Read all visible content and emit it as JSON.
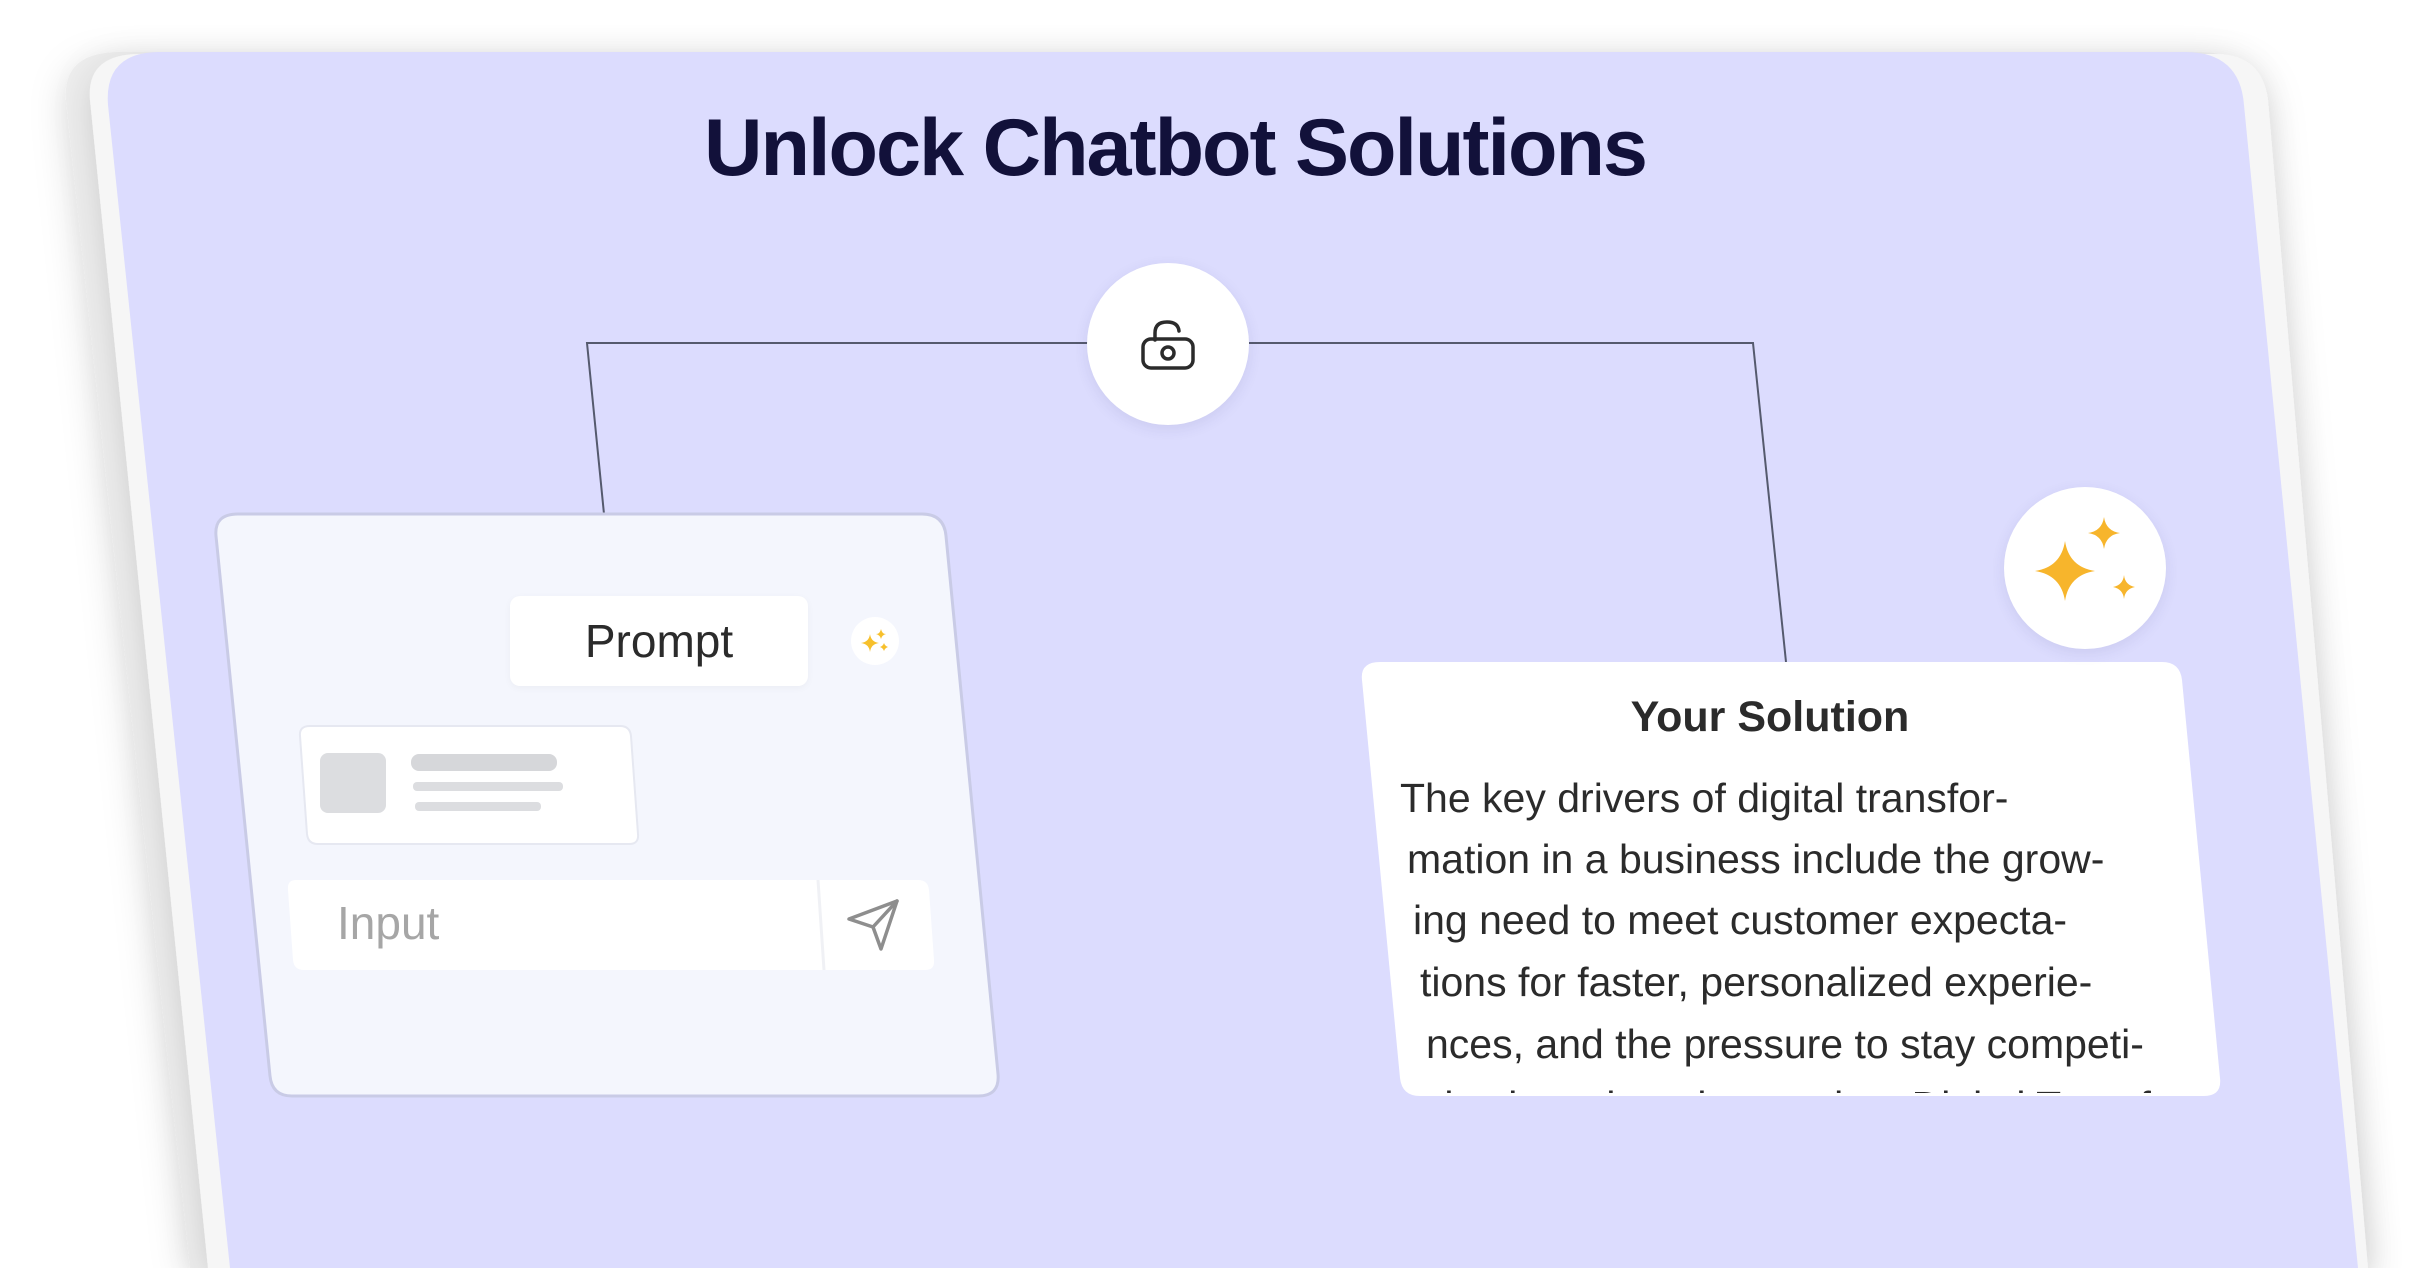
{
  "title": "Unlock Chatbot Solutions",
  "colors": {
    "card_background": "#dcdcfe",
    "title": "#12113a",
    "sparkle": "#f7b52c",
    "panel": "#f4f6fd",
    "line": "#555a6e"
  },
  "icons": {
    "lock": "unlocked-padlock-icon",
    "sparkle": "sparkles-icon",
    "send": "paper-plane-send-icon"
  },
  "chat_panel": {
    "prompt_label": "Prompt",
    "input_placeholder": "Input"
  },
  "solution_panel": {
    "title": "Your Solution",
    "lines": [
      "The key drivers of digital transfor-",
      "mation in a business include the grow-",
      "ing need to meet customer expecta-",
      "tions for faster, personalized experie-",
      "nces, and the pressure to stay competi-",
      "tive in a changing market. Digital Transfor-"
    ]
  }
}
